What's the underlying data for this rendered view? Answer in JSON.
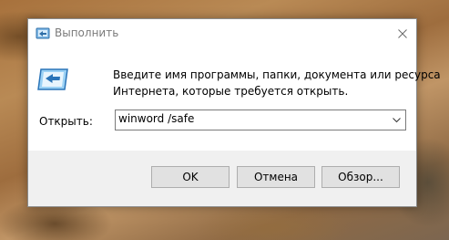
{
  "window": {
    "title": "Выполнить",
    "title_icon": "run-icon",
    "close_icon": "close-icon"
  },
  "content": {
    "description_line1": "Введите имя программы, папки, документа или ресурса",
    "description_line2": "Интернета, которые требуется открыть.",
    "app_icon": "run-dialog-icon"
  },
  "open": {
    "label": "Открыть:",
    "value": "winword /safe",
    "dropdown_icon": "chevron-down-icon"
  },
  "buttons": {
    "ok": "OK",
    "cancel": "Отмена",
    "browse": "Обзор..."
  }
}
